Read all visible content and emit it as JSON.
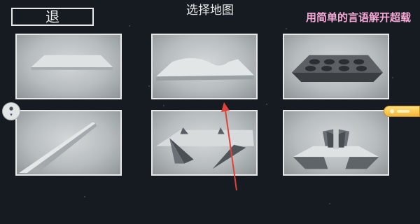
{
  "header": {
    "back_label": "退",
    "title": "选择地图",
    "scroll_text": "用简单的言语解开超载"
  },
  "maps": [
    {
      "shape": "flat-slab"
    },
    {
      "shape": "wave-ramp"
    },
    {
      "shape": "pit-grid"
    },
    {
      "shape": "diagonal-ramp"
    },
    {
      "shape": "spike-field"
    },
    {
      "shape": "tower-base"
    }
  ],
  "side_buttons": {
    "left_icon": "floating-assistant-icon",
    "right_icon": "gold-badge-icon"
  },
  "colors": {
    "background": "#151b20",
    "border": "#e8e8e8",
    "scroll_text": "#f7a8d8",
    "arrow": "#e0413a"
  }
}
